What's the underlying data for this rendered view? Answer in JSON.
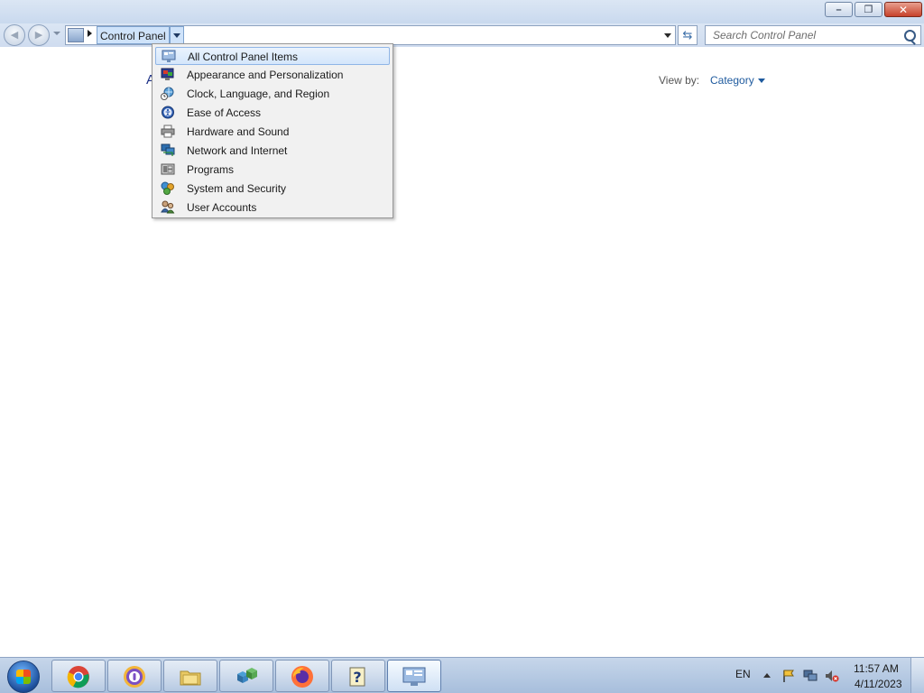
{
  "window": {
    "minimize_glyph": "–",
    "restore_glyph": "❐",
    "close_glyph": "✕"
  },
  "address_bar": {
    "breadcrumb": "Control Panel",
    "search_placeholder": "Search Control Panel"
  },
  "content": {
    "partial_heading": "A",
    "view_by_label": "View by:",
    "view_by_value": "Category"
  },
  "breadcrumb_menu": {
    "items": [
      {
        "label": "All Control Panel Items",
        "icon": "control-panel-icon",
        "highlighted": true
      },
      {
        "label": "Appearance and Personalization",
        "icon": "appearance-icon"
      },
      {
        "label": "Clock, Language, and Region",
        "icon": "clock-globe-icon"
      },
      {
        "label": "Ease of Access",
        "icon": "ease-of-access-icon"
      },
      {
        "label": "Hardware and Sound",
        "icon": "printer-icon"
      },
      {
        "label": "Network and Internet",
        "icon": "network-icon"
      },
      {
        "label": "Programs",
        "icon": "programs-icon"
      },
      {
        "label": "System and Security",
        "icon": "shield-icon"
      },
      {
        "label": "User Accounts",
        "icon": "users-icon"
      }
    ]
  },
  "taskbar": {
    "apps": [
      {
        "name": "Google Chrome",
        "icon": "chrome-icon"
      },
      {
        "name": "Security app",
        "icon": "lock-app-icon"
      },
      {
        "name": "Windows Explorer",
        "icon": "folder-icon"
      },
      {
        "name": "Registry tool",
        "icon": "cubes-icon"
      },
      {
        "name": "Firefox",
        "icon": "firefox-icon"
      },
      {
        "name": "Help",
        "icon": "help-icon"
      },
      {
        "name": "Control Panel",
        "icon": "control-panel-icon",
        "active": true
      }
    ],
    "language": "EN",
    "time": "11:57 AM",
    "date": "4/11/2023"
  },
  "colors": {
    "link_blue": "#1e5a9e",
    "menu_highlight": "#d4e6fb",
    "taskbar": "#a7bedc"
  }
}
